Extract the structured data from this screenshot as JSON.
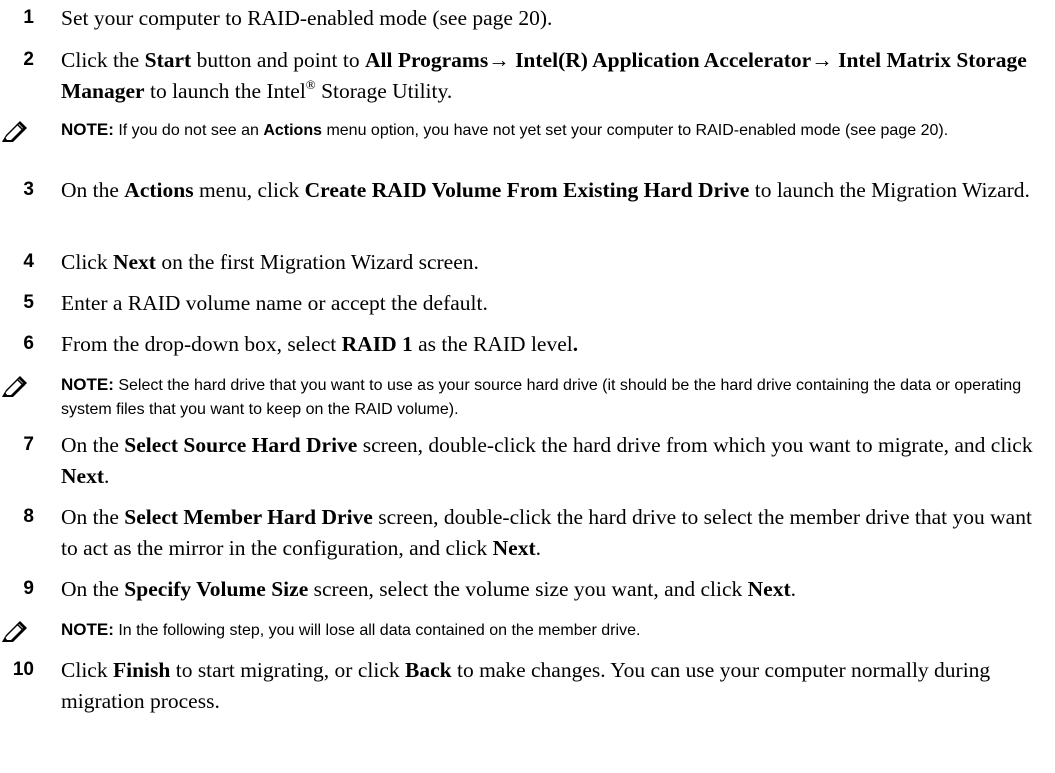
{
  "note_label": "NOTE:",
  "steps": {
    "s1": {
      "num": "1",
      "t1": "Set your computer to RAID-enabled mode (see page 20)."
    },
    "s2": {
      "num": "2",
      "t1": "Click the ",
      "b1": "Start",
      "t2": " button and point to ",
      "b2": "All Programs→ Intel(R) Application Accelerator→ Intel Matrix Storage Manager",
      "t3": " to launch the Intel",
      "sup": "®",
      "t4": " Storage Utility."
    },
    "s3": {
      "num": "3",
      "t1": "On the ",
      "b1": "Actions",
      "t2": " menu, click ",
      "b2": "Create RAID Volume From Existing Hard Drive",
      "t3": " to launch the Migration Wizard."
    },
    "s4": {
      "num": "4",
      "t1": "Click ",
      "b1": "Next",
      "t2": " on the first Migration Wizard screen."
    },
    "s5": {
      "num": "5",
      "t1": "Enter a RAID volume name or accept the default."
    },
    "s6": {
      "num": "6",
      "t1": "From the drop-down box, select ",
      "b1": "RAID 1",
      "t2": " as the RAID level",
      "b2": "."
    },
    "s7": {
      "num": "7",
      "t1": "On the ",
      "b1": "Select Source Hard Drive",
      "t2": " screen, double-click the hard drive from which you want to migrate, and click ",
      "b2": "Next",
      "t3": "."
    },
    "s8": {
      "num": "8",
      "t1": "On the ",
      "b1": "Select Member Hard Drive",
      "t2": " screen, double-click the hard drive to select the member drive that you want to act as the mirror in the configuration, and click ",
      "b2": "Next",
      "t3": "."
    },
    "s9": {
      "num": "9",
      "t1": "On the ",
      "b1": "Specify Volume Size",
      "t2": " screen, select the volume size you want, and click ",
      "b2": "Next",
      "t3": "."
    },
    "s10": {
      "num": "10",
      "t1": "Click ",
      "b1": "Finish",
      "t2": " to start migrating, or click ",
      "b2": "Back",
      "t3": " to make changes. You can use your computer normally during migration process."
    }
  },
  "notes": {
    "n1": {
      "t1": " If you do not see an ",
      "b1": "Actions",
      "t2": " menu option, you have not yet set your computer to RAID-enabled mode (see page 20)."
    },
    "n2": {
      "t1": " Select the hard drive that you want to use as your source hard drive (it should be the hard drive containing the data or operating system files that you want to keep on the RAID volume)."
    },
    "n3": {
      "t1": " In the following step, you will lose all data contained on the member drive."
    }
  }
}
